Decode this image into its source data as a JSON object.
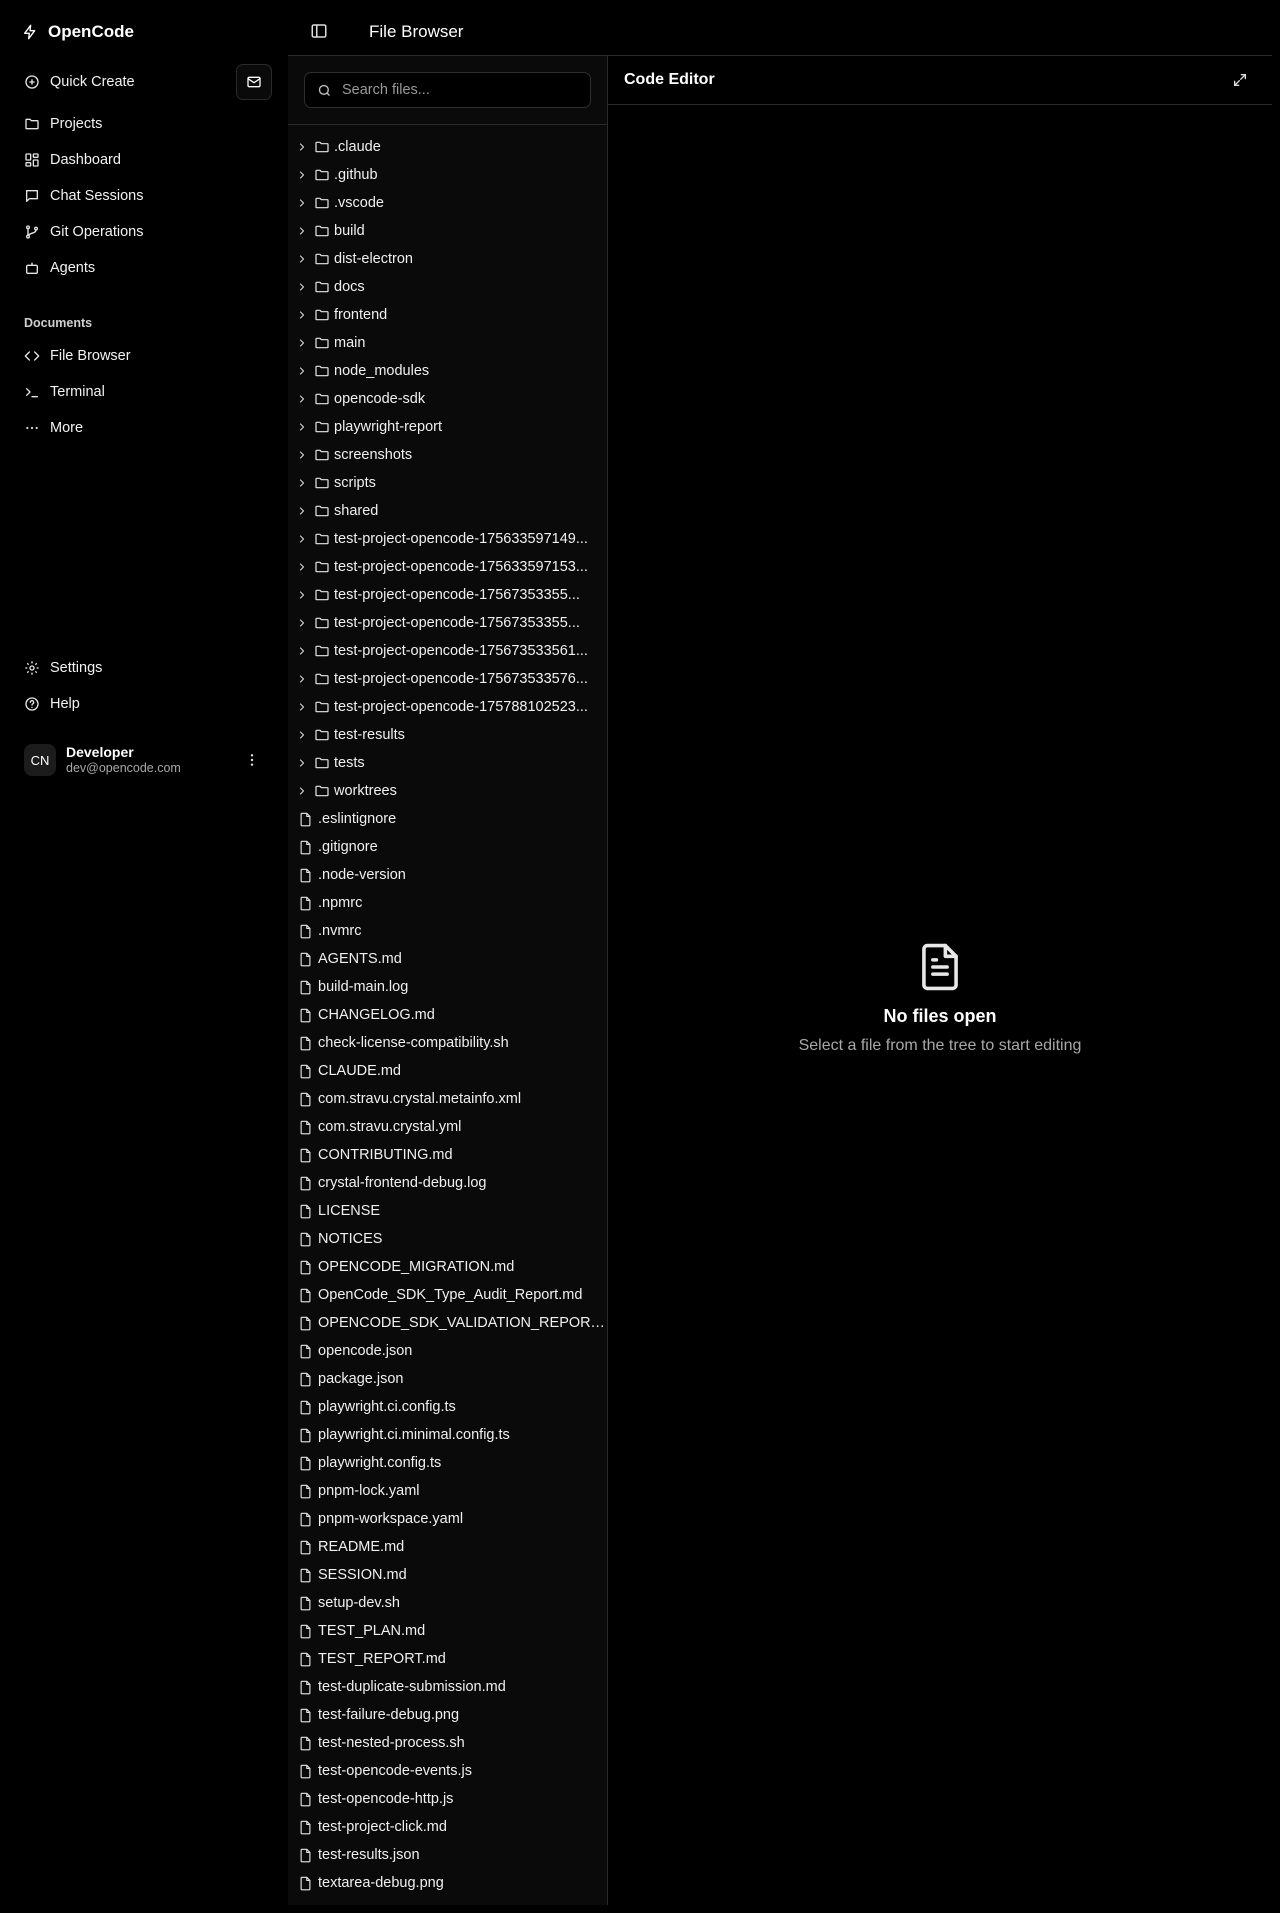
{
  "brand": {
    "name": "OpenCode",
    "icon": "bolt-icon"
  },
  "sidebar": {
    "quick_create": "Quick Create",
    "main_items": [
      {
        "label": "Projects",
        "icon": "folder-icon"
      },
      {
        "label": "Dashboard",
        "icon": "dashboard-icon"
      },
      {
        "label": "Chat Sessions",
        "icon": "chat-icon"
      },
      {
        "label": "Git Operations",
        "icon": "git-branch-icon"
      },
      {
        "label": "Agents",
        "icon": "bot-icon"
      }
    ],
    "section_label": "Documents",
    "doc_items": [
      {
        "label": "File Browser",
        "icon": "code-icon"
      },
      {
        "label": "Terminal",
        "icon": "terminal-icon"
      },
      {
        "label": "More",
        "icon": "ellipsis-icon"
      }
    ],
    "bottom_items": [
      {
        "label": "Settings",
        "icon": "gear-icon"
      },
      {
        "label": "Help",
        "icon": "help-icon"
      }
    ],
    "user": {
      "initials": "CN",
      "name": "Developer",
      "email": "dev@opencode.com"
    }
  },
  "topbar": {
    "title": "File Browser"
  },
  "file_panel": {
    "search_placeholder": "Search files...",
    "folders": [
      ".claude",
      ".github",
      ".vscode",
      "build",
      "dist-electron",
      "docs",
      "frontend",
      "main",
      "node_modules",
      "opencode-sdk",
      "playwright-report",
      "screenshots",
      "scripts",
      "shared",
      "test-project-opencode-175633597149...",
      "test-project-opencode-175633597153...",
      "test-project-opencode-17567353355...",
      "test-project-opencode-17567353355...",
      "test-project-opencode-175673533561...",
      "test-project-opencode-175673533576...",
      "test-project-opencode-175788102523...",
      "test-results",
      "tests",
      "worktrees"
    ],
    "files": [
      ".eslintignore",
      ".gitignore",
      ".node-version",
      ".npmrc",
      ".nvmrc",
      "AGENTS.md",
      "build-main.log",
      "CHANGELOG.md",
      "check-license-compatibility.sh",
      "CLAUDE.md",
      "com.stravu.crystal.metainfo.xml",
      "com.stravu.crystal.yml",
      "CONTRIBUTING.md",
      "crystal-frontend-debug.log",
      "LICENSE",
      "NOTICES",
      "OPENCODE_MIGRATION.md",
      "OpenCode_SDK_Type_Audit_Report.md",
      "OPENCODE_SDK_VALIDATION_REPORT....",
      "opencode.json",
      "package.json",
      "playwright.ci.config.ts",
      "playwright.ci.minimal.config.ts",
      "playwright.config.ts",
      "pnpm-lock.yaml",
      "pnpm-workspace.yaml",
      "README.md",
      "SESSION.md",
      "setup-dev.sh",
      "TEST_PLAN.md",
      "TEST_REPORT.md",
      "test-duplicate-submission.md",
      "test-failure-debug.png",
      "test-nested-process.sh",
      "test-opencode-events.js",
      "test-opencode-http.js",
      "test-project-click.md",
      "test-results.json",
      "textarea-debug.png"
    ]
  },
  "editor": {
    "title": "Code Editor",
    "empty_title": "No files open",
    "empty_subtitle": "Select a file from the tree to start editing"
  }
}
